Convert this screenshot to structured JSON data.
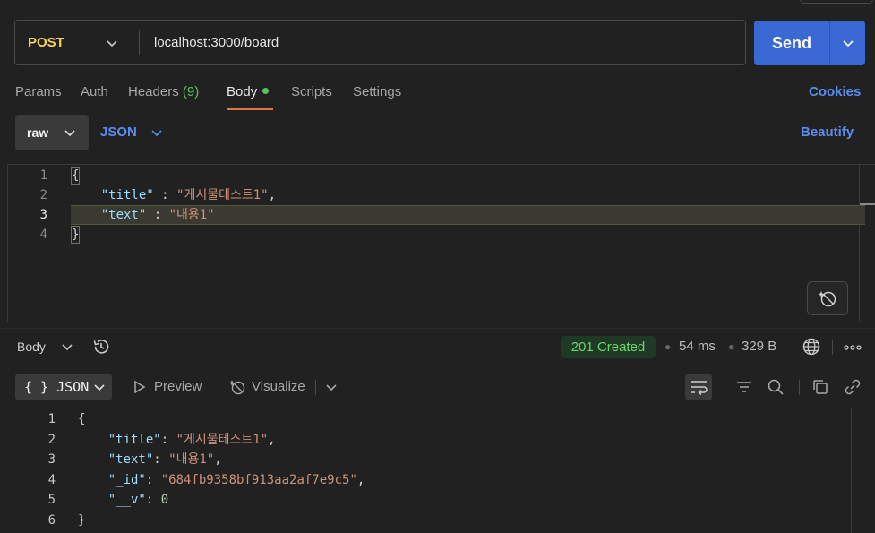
{
  "request": {
    "method": "POST",
    "url": "localhost:3000/board",
    "send_label": "Send"
  },
  "request_tabs": [
    {
      "label": "Params"
    },
    {
      "label": "Auth"
    },
    {
      "label": "Headers",
      "count": "(9)"
    },
    {
      "label": "Body",
      "active": true
    },
    {
      "label": "Scripts"
    },
    {
      "label": "Settings"
    }
  ],
  "cookies_label": "Cookies",
  "body_type": {
    "mode": "raw",
    "language": "JSON",
    "beautify_label": "Beautify"
  },
  "request_body": {
    "line_numbers": [
      "1",
      "2",
      "3",
      "4"
    ],
    "open_brace": "{",
    "close_brace": "}",
    "line2": {
      "key": "\"title\"",
      "sep": " : ",
      "value": "\"게시물테스트1\"",
      "end": ","
    },
    "line3": {
      "key": "\"text\"",
      "sep": " : ",
      "value": "\"내용1\""
    }
  },
  "response": {
    "body_label": "Body",
    "status": "201 Created",
    "time": "54 ms",
    "size": "329 B",
    "view_mode": "{ } JSON",
    "preview_label": "Preview",
    "visualize_label": "Visualize",
    "line_numbers": [
      "1",
      "2",
      "3",
      "4",
      "5",
      "6"
    ],
    "open_brace": "{",
    "close_brace": "}",
    "lines": [
      {
        "key": "\"title\"",
        "value": "\"게시물테스트1\"",
        "end": ","
      },
      {
        "key": "\"text\"",
        "value": "\"내용1\"",
        "end": ","
      },
      {
        "key": "\"_id\"",
        "value": "\"684fb9358bf913aa2af7e9c5\"",
        "end": ","
      },
      {
        "key": "\"__v\"",
        "value": "0",
        "end": ""
      }
    ]
  },
  "colors": {
    "accent_blue": "#3b69d3",
    "link_blue": "#5b8df0",
    "method_yellow": "#f7d060",
    "status_green": "#6fd46f",
    "tab_underline": "#e2744a"
  }
}
